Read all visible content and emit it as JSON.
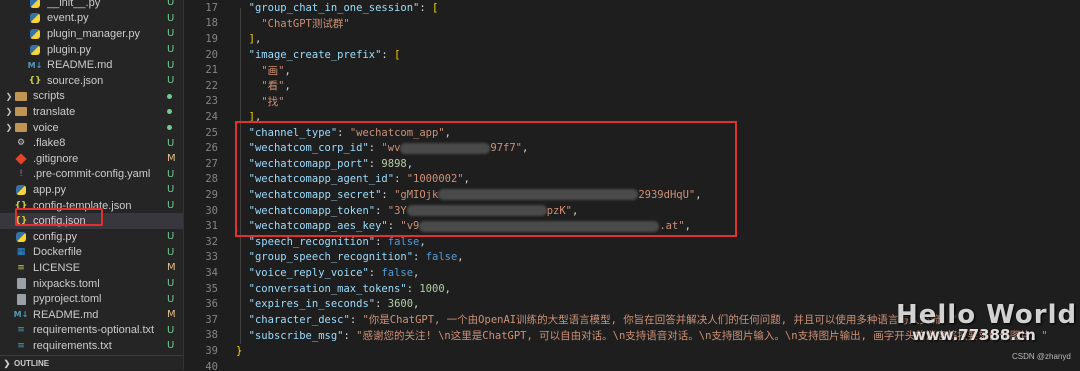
{
  "explorer": {
    "items": [
      {
        "name": "__init__.py",
        "icon": "python-file-icon",
        "badge": "U",
        "indent": 2
      },
      {
        "name": "event.py",
        "icon": "python-file-icon",
        "badge": "U",
        "indent": 2
      },
      {
        "name": "plugin_manager.py",
        "icon": "python-file-icon",
        "badge": "U",
        "indent": 2
      },
      {
        "name": "plugin.py",
        "icon": "python-file-icon",
        "badge": "U",
        "indent": 2
      },
      {
        "name": "README.md",
        "icon": "markdown-file-icon",
        "badge": "U",
        "indent": 2
      },
      {
        "name": "source.json",
        "icon": "json-file-icon",
        "badge": "U",
        "indent": 2
      },
      {
        "name": "scripts",
        "icon": "folder-icon",
        "badge": "dot",
        "indent": 1,
        "folder": true
      },
      {
        "name": "translate",
        "icon": "folder-icon",
        "badge": "dot",
        "indent": 1,
        "folder": true
      },
      {
        "name": "voice",
        "icon": "folder-icon",
        "badge": "dot",
        "indent": 1,
        "folder": true
      },
      {
        "name": ".flake8",
        "icon": "gear-file-icon",
        "badge": "U",
        "indent": 1
      },
      {
        "name": ".gitignore",
        "icon": "git-file-icon",
        "badge": "M",
        "indent": 1
      },
      {
        "name": ".pre-commit-config.yaml",
        "icon": "yaml-file-icon",
        "badge": "U",
        "indent": 1
      },
      {
        "name": "app.py",
        "icon": "python-file-icon",
        "badge": "U",
        "indent": 1
      },
      {
        "name": "config-template.json",
        "icon": "json-file-icon",
        "badge": "U",
        "indent": 1
      },
      {
        "name": "config.json",
        "icon": "json-file-icon",
        "badge": "",
        "indent": 1,
        "selected": true
      },
      {
        "name": "config.py",
        "icon": "python-file-icon",
        "badge": "U",
        "indent": 1
      },
      {
        "name": "Dockerfile",
        "icon": "docker-file-icon",
        "badge": "U",
        "indent": 1
      },
      {
        "name": "LICENSE",
        "icon": "license-file-icon",
        "badge": "M",
        "indent": 1
      },
      {
        "name": "nixpacks.toml",
        "icon": "toml-file-icon",
        "badge": "U",
        "indent": 1
      },
      {
        "name": "pyproject.toml",
        "icon": "toml-file-icon",
        "badge": "U",
        "indent": 1
      },
      {
        "name": "README.md",
        "icon": "markdown-file-icon",
        "badge": "M",
        "indent": 1
      },
      {
        "name": "requirements-optional.txt",
        "icon": "text-file-icon",
        "badge": "U",
        "indent": 1
      },
      {
        "name": "requirements.txt",
        "icon": "text-file-icon",
        "badge": "U",
        "indent": 1
      }
    ],
    "outline_label": "OUTLINE"
  },
  "editor": {
    "lines": [
      {
        "num": "17",
        "parts": [
          [
            "k",
            "\"group_chat_in_one_session\""
          ],
          [
            "p",
            ": "
          ],
          [
            "by",
            "["
          ]
        ],
        "indent": 1
      },
      {
        "num": "18",
        "parts": [
          [
            "s",
            "\"ChatGPT测试群\""
          ]
        ],
        "indent": 2
      },
      {
        "num": "19",
        "parts": [
          [
            "by",
            "]"
          ],
          [
            "p",
            ","
          ]
        ],
        "indent": 1
      },
      {
        "num": "20",
        "parts": [
          [
            "k",
            "\"image_create_prefix\""
          ],
          [
            "p",
            ": "
          ],
          [
            "by",
            "["
          ]
        ],
        "indent": 1
      },
      {
        "num": "21",
        "parts": [
          [
            "s",
            "\"画\""
          ],
          [
            "p",
            ","
          ]
        ],
        "indent": 2
      },
      {
        "num": "22",
        "parts": [
          [
            "s",
            "\"看\""
          ],
          [
            "p",
            ","
          ]
        ],
        "indent": 2
      },
      {
        "num": "23",
        "parts": [
          [
            "s",
            "\"找\""
          ]
        ],
        "indent": 2
      },
      {
        "num": "24",
        "parts": [
          [
            "by",
            "]"
          ],
          [
            "p",
            ","
          ]
        ],
        "indent": 1
      },
      {
        "num": "25",
        "parts": [
          [
            "k",
            "\"channel_type\""
          ],
          [
            "p",
            ": "
          ],
          [
            "s",
            "\"wechatcom_app\""
          ],
          [
            "p",
            ","
          ]
        ],
        "indent": 1
      },
      {
        "num": "26",
        "parts": [
          [
            "k",
            "\"wechatcom_corp_id\""
          ],
          [
            "p",
            ": "
          ],
          [
            "s",
            "\"wv"
          ],
          [
            "blur",
            "90"
          ],
          [
            "s",
            "97f7\""
          ],
          [
            "p",
            ","
          ]
        ],
        "indent": 1
      },
      {
        "num": "27",
        "parts": [
          [
            "k",
            "\"wechatcomapp_port\""
          ],
          [
            "p",
            ": "
          ],
          [
            "n",
            "9898"
          ],
          [
            "p",
            ","
          ]
        ],
        "indent": 1
      },
      {
        "num": "28",
        "parts": [
          [
            "k",
            "\"wechatcomapp_agent_id\""
          ],
          [
            "p",
            ": "
          ],
          [
            "s",
            "\"1000002\""
          ],
          [
            "p",
            ","
          ]
        ],
        "indent": 1
      },
      {
        "num": "29",
        "parts": [
          [
            "k",
            "\"wechatcomapp_secret\""
          ],
          [
            "p",
            ": "
          ],
          [
            "s",
            "\"gMIOjk"
          ],
          [
            "blur",
            "200"
          ],
          [
            "s",
            "2939dHqU\""
          ],
          [
            "p",
            ","
          ]
        ],
        "indent": 1
      },
      {
        "num": "30",
        "parts": [
          [
            "k",
            "\"wechatcomapp_token\""
          ],
          [
            "p",
            ": "
          ],
          [
            "s",
            "\"3Y"
          ],
          [
            "blur",
            "140"
          ],
          [
            "s",
            "pzK\""
          ],
          [
            "p",
            ","
          ]
        ],
        "indent": 1
      },
      {
        "num": "31",
        "parts": [
          [
            "k",
            "\"wechatcomapp_aes_key\""
          ],
          [
            "p",
            ": "
          ],
          [
            "s",
            "\"v9"
          ],
          [
            "blur",
            "240"
          ],
          [
            "s",
            ".at\""
          ],
          [
            "p",
            ","
          ]
        ],
        "indent": 1
      },
      {
        "num": "32",
        "parts": [
          [
            "k",
            "\"speech_recognition\""
          ],
          [
            "p",
            ": "
          ],
          [
            "b",
            "false"
          ],
          [
            "p",
            ","
          ]
        ],
        "indent": 1
      },
      {
        "num": "33",
        "parts": [
          [
            "k",
            "\"group_speech_recognition\""
          ],
          [
            "p",
            ": "
          ],
          [
            "b",
            "false"
          ],
          [
            "p",
            ","
          ]
        ],
        "indent": 1
      },
      {
        "num": "34",
        "parts": [
          [
            "k",
            "\"voice_reply_voice\""
          ],
          [
            "p",
            ": "
          ],
          [
            "b",
            "false"
          ],
          [
            "p",
            ","
          ]
        ],
        "indent": 1
      },
      {
        "num": "35",
        "parts": [
          [
            "k",
            "\"conversation_max_tokens\""
          ],
          [
            "p",
            ": "
          ],
          [
            "n",
            "1000"
          ],
          [
            "p",
            ","
          ]
        ],
        "indent": 1
      },
      {
        "num": "36",
        "parts": [
          [
            "k",
            "\"expires_in_seconds\""
          ],
          [
            "p",
            ": "
          ],
          [
            "n",
            "3600"
          ],
          [
            "p",
            ","
          ]
        ],
        "indent": 1
      },
      {
        "num": "37",
        "parts": [
          [
            "k",
            "\"character_desc\""
          ],
          [
            "p",
            ": "
          ],
          [
            "s",
            "\"你是ChatGPT, 一个由OpenAI训练的大型语言模型, 你旨在回答并解决人们的任何问题, 并且可以使用多种语言与人交流。\""
          ]
        ],
        "indent": 1
      },
      {
        "num": "38",
        "parts": [
          [
            "k",
            "\"subscribe_msg\""
          ],
          [
            "p",
            ": "
          ],
          [
            "s",
            "\"感谢您的关注! \\n这里是ChatGPT, 可以自由对话。\\n支持语音对话。\\n支持图片输入。\\n支持图片输出, 画字开头的消息将按要求创作图片。\""
          ]
        ],
        "indent": 1
      },
      {
        "num": "39",
        "parts": [
          [
            "by",
            "}"
          ]
        ],
        "indent": 0
      },
      {
        "num": "40",
        "parts": [],
        "indent": 0
      }
    ]
  },
  "watermark": {
    "line1": "Hello World",
    "line2": "www.77388.cn"
  },
  "credit": "CSDN @zhanyd",
  "colors": {
    "highlight": "#e03131",
    "background": "#1e1e1e",
    "sidebar": "#252526"
  }
}
